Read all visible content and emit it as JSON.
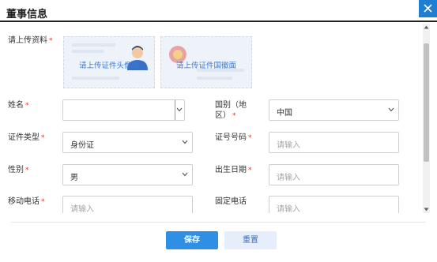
{
  "dialog": {
    "title": "董事信息"
  },
  "colors": {
    "accent": "#1e7fd2",
    "primary_button": "#2e8fe5",
    "required": "#e5312b"
  },
  "upload": {
    "label": "请上传资料",
    "front_text": "请上传证件头像面",
    "back_text": "请上传证件国徽面"
  },
  "form": {
    "name_label": "姓名",
    "country_label_line1": "国别（地",
    "country_label_line2": "区）",
    "country_value": "中国",
    "id_type_label": "证件类型",
    "id_type_value": "身份证",
    "id_number_label": "证号号码",
    "id_number_placeholder": "请输入",
    "gender_label": "性别",
    "gender_value": "男",
    "birth_label": "出生日期",
    "birth_placeholder": "请输入",
    "mobile_label": "移动电话",
    "mobile_placeholder": "请输入",
    "phone_label": "固定电话",
    "phone_placeholder": "请输入",
    "required_mark": "*"
  },
  "buttons": {
    "save": "保存",
    "reset": "重置"
  },
  "icons": {
    "close": "close-icon",
    "dropdown": "chevron-down-icon"
  }
}
